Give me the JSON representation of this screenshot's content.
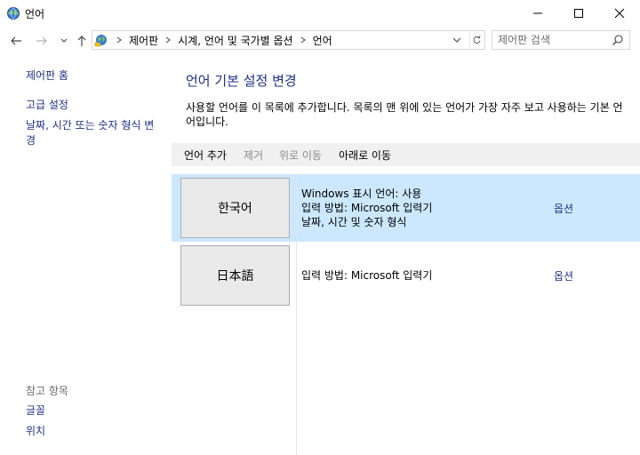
{
  "window": {
    "title": "언어",
    "minimize_icon": "minimize-icon",
    "maximize_icon": "maximize-icon",
    "close_icon": "close-icon"
  },
  "navigation": {
    "breadcrumbs": [
      "제어판",
      "시계, 언어 및 국가별 옵션",
      "언어"
    ],
    "search_placeholder": "제어판 검색"
  },
  "sidebar": {
    "home": "제어판 홈",
    "advanced_settings": "고급 설정",
    "date_time_format": "날짜, 시간 또는 숫자 형식 변경",
    "see_also_header": "참고 항목",
    "fonts": "글꼴",
    "location": "위치"
  },
  "main": {
    "title": "언어 기본 설정 변경",
    "description": "사용할 언어를 이 목록에 추가합니다. 목록의 맨 위에 있는 언어가 가장 자주 보고 사용하는 기본 언어입니다.",
    "toolbar": {
      "add": "언어 추가",
      "remove": "제거",
      "move_up": "위로 이동",
      "move_down": "아래로 이동"
    },
    "languages": [
      {
        "name": "한국어",
        "details": [
          "Windows 표시 언어: 사용",
          "입력 방법: Microsoft 입력기",
          "날짜, 시간 및 숫자 형식"
        ],
        "options": "옵션"
      },
      {
        "name": "日本語",
        "details": [
          "입력 방법: Microsoft 입력기"
        ],
        "options": "옵션"
      }
    ]
  },
  "colors": {
    "link": "#1e3287",
    "selected_row": "#cce8ff",
    "toolbar_bg": "#f0f0f0",
    "disabled_text": "#8a8a8a"
  }
}
